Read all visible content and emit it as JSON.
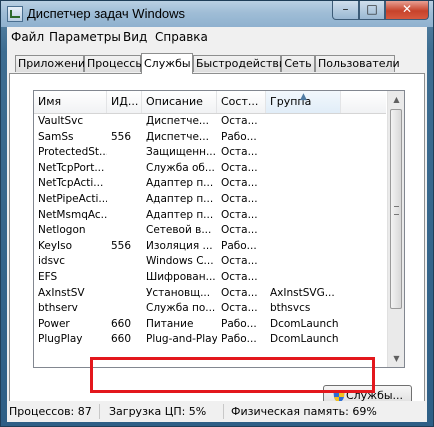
{
  "window": {
    "title": "Диспетчер задач Windows",
    "buttons": {
      "minimize": "–",
      "maximize": "□",
      "close": "✕"
    }
  },
  "menu": [
    {
      "label": "Файл"
    },
    {
      "label": "Параметры"
    },
    {
      "label": "Вид"
    },
    {
      "label": "Справка"
    }
  ],
  "tabs": [
    {
      "label": "Приложения"
    },
    {
      "label": "Процессы"
    },
    {
      "label": "Службы"
    },
    {
      "label": "Быстродействие"
    },
    {
      "label": "Сеть"
    },
    {
      "label": "Пользователи"
    }
  ],
  "active_tab": "Службы",
  "table": {
    "columns": [
      "Имя",
      "ИД...",
      "Описание",
      "Сост...",
      "Группа"
    ],
    "sorted_column": "Группа",
    "rows": [
      [
        "VaultSvc",
        "",
        "Диспетче...",
        "Оста...",
        ""
      ],
      [
        "SamSs",
        "556",
        "Диспетче...",
        "Рабо...",
        ""
      ],
      [
        "ProtectedSt...",
        "",
        "Защищенн...",
        "Оста...",
        ""
      ],
      [
        "NetTcpPort...",
        "",
        "Служба об...",
        "Оста...",
        ""
      ],
      [
        "NetTcpActi...",
        "",
        "Адаптер п...",
        "Оста...",
        ""
      ],
      [
        "NetPipeActi...",
        "",
        "Адаптер п...",
        "Оста...",
        ""
      ],
      [
        "NetMsmqAc...",
        "",
        "Адаптер п...",
        "Оста...",
        ""
      ],
      [
        "Netlogon",
        "",
        "Сетевой в...",
        "Оста...",
        ""
      ],
      [
        "KeyIso",
        "556",
        "Изоляция ...",
        "Рабо...",
        ""
      ],
      [
        "idsvc",
        "",
        "Windows C...",
        "Оста...",
        ""
      ],
      [
        "EFS",
        "",
        "Шифрован...",
        "Оста...",
        ""
      ],
      [
        "AxInstSV",
        "",
        "Установщ...",
        "Оста...",
        "AxInstSVG..."
      ],
      [
        "bthserv",
        "",
        "Служба по...",
        "Оста...",
        "bthsvcs"
      ],
      [
        "Power",
        "660",
        "Питание",
        "Рабо...",
        "DcomLaunch"
      ],
      [
        "PlugPlay",
        "660",
        "Plug-and-Play",
        "Рабо...",
        "DcomLaunch"
      ]
    ]
  },
  "services_button": "Службы...",
  "status": {
    "processes": "Процессов: 87",
    "cpu": "Загрузка ЦП: 5%",
    "memory": "Физическая память: 69%"
  },
  "colors": {
    "highlight_border": "#e3171c",
    "titlebar": "#9fbdd6"
  }
}
